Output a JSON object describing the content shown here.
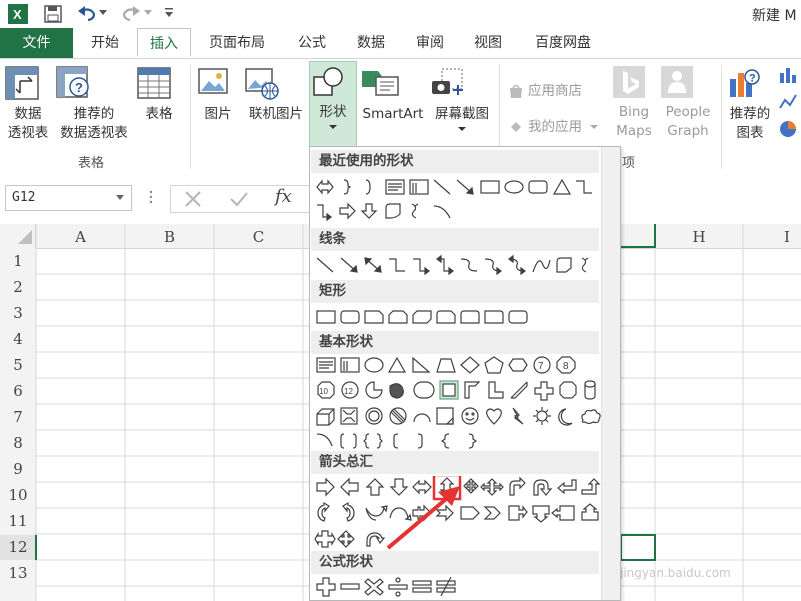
{
  "window": {
    "title": "新建 M"
  },
  "tabs": [
    {
      "label": "文件"
    },
    {
      "label": "开始"
    },
    {
      "label": "插入"
    },
    {
      "label": "页面布局"
    },
    {
      "label": "公式"
    },
    {
      "label": "数据"
    },
    {
      "label": "审阅"
    },
    {
      "label": "视图"
    },
    {
      "label": "百度网盘"
    }
  ],
  "ribbon": {
    "pivot_line1": "数据",
    "pivot_line2": "透视表",
    "rec_pivot_line1": "推荐的",
    "rec_pivot_line2": "数据透视表",
    "table": "表格",
    "group_tables": "表格",
    "picture": "图片",
    "online_picture": "联机图片",
    "shapes": "形状",
    "smartart": "SmartArt",
    "screenshot": "屏幕截图",
    "app_store": "应用商店",
    "my_apps": "我的应用",
    "bing_line1": "Bing",
    "bing_line2": "Maps",
    "people_line1": "People",
    "people_line2": "Graph",
    "group_apps_tail": "项",
    "rec_chart_line1": "推荐的",
    "rec_chart_line2": "图表"
  },
  "formula": {
    "namebox": "G12",
    "fx": "fx"
  },
  "columns": [
    "A",
    "B",
    "C",
    "H",
    "I"
  ],
  "rows": [
    "1",
    "2",
    "3",
    "4",
    "5",
    "6",
    "7",
    "8",
    "9",
    "10",
    "11",
    "12",
    "13"
  ],
  "shapes_menu": {
    "sections": [
      {
        "title": "最近使用的形状"
      },
      {
        "title": "线条"
      },
      {
        "title": "矩形"
      },
      {
        "title": "基本形状"
      },
      {
        "title": "箭头总汇"
      },
      {
        "title": "公式形状"
      }
    ],
    "selected_shape": "up-down-arrow"
  },
  "watermark": "jingyan.baidu.com",
  "colors": {
    "brand": "#217346",
    "highlight_box": "#e33333",
    "shape_stroke": "#404040"
  }
}
